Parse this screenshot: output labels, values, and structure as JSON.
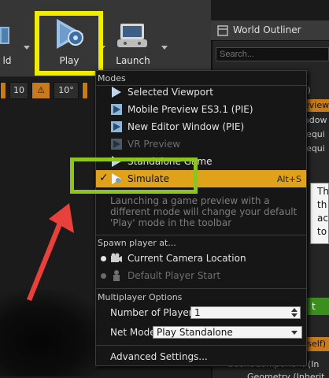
{
  "toolbar": {
    "world_label": "ld",
    "play_label": "Play",
    "launch_label": "Launch"
  },
  "viewport": {
    "chips": [
      {
        "label": "10",
        "style": "normal"
      },
      {
        "label": "⚠",
        "style": "orange"
      },
      {
        "label": "10°",
        "style": "normal"
      }
    ]
  },
  "outliner": {
    "title": "World Outliner",
    "search_placeholder": "Search...",
    "rows": [
      "r)",
      "eview",
      "adow",
      "lequi",
      "lequi"
    ],
    "tooltip_lines": [
      "Th",
      "th",
      "ac",
      "to"
    ],
    "green_chip": "t",
    "self_label": "(self)",
    "bottom_rows": [
      "SceneComponent (In",
      "Geometry (Inherit"
    ]
  },
  "menu": {
    "modes_header": "Modes",
    "items": [
      {
        "label": "Selected Viewport",
        "disabled": false,
        "selected": false
      },
      {
        "label": "Mobile Preview ES3.1 (PIE)",
        "disabled": false,
        "selected": false
      },
      {
        "label": "New Editor Window (PIE)",
        "disabled": false,
        "selected": false
      },
      {
        "label": "VR Preview",
        "disabled": true,
        "selected": false
      },
      {
        "label": "Standalone Game",
        "disabled": false,
        "selected": false
      },
      {
        "label": "Simulate",
        "disabled": false,
        "selected": true,
        "shortcut": "Alt+S"
      }
    ],
    "description": "Launching a game preview with a different mode will change your default 'Play' mode in the toolbar",
    "spawn_header": "Spawn player at...",
    "spawn_items": [
      {
        "label": "Current Camera Location",
        "selected": true
      },
      {
        "label": "Default Player Start",
        "selected": false
      }
    ],
    "multiplayer_header": "Multiplayer Options",
    "num_players_label": "Number of Players",
    "num_players_value": "1",
    "net_mode_label": "Net Mode",
    "net_mode_value": "Play Standalone",
    "advanced_label": "Advanced Settings..."
  },
  "colors": {
    "play_highlight": "#f1ec00",
    "simulate_highlight": "#8fc31f",
    "selected_item": "#e0a21a",
    "arrow": "#e8403a"
  }
}
